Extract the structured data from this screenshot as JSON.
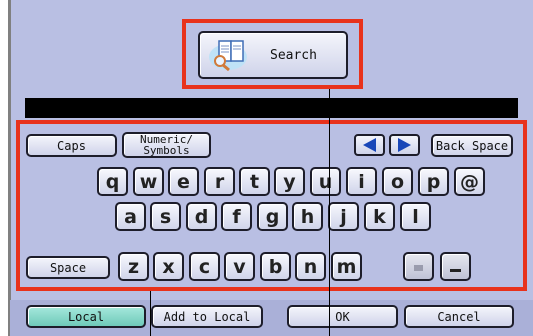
{
  "search": {
    "label": "Search",
    "icon": "book-magnifier-icon"
  },
  "toolbar": {
    "caps_label": "Caps",
    "numeric_label_line1": "Numeric/",
    "numeric_label_line2": "Symbols",
    "backspace_label": "Back Space",
    "left_arrow_icon": "triangle-left-icon",
    "right_arrow_icon": "triangle-right-icon"
  },
  "keyboard": {
    "row1": [
      "q",
      "w",
      "e",
      "r",
      "t",
      "y",
      "u",
      "i",
      "o",
      "p",
      "@"
    ],
    "row2": [
      "a",
      "s",
      "d",
      "f",
      "g",
      "h",
      "j",
      "k",
      "l"
    ],
    "row3": [
      "z",
      "x",
      "c",
      "v",
      "b",
      "n",
      "m"
    ],
    "space_label": "Space"
  },
  "bottom": {
    "local_label": "Local",
    "add_to_local_label": "Add to Local",
    "ok_label": "OK",
    "cancel_label": "Cancel"
  },
  "colors": {
    "panel": "#b9bfe3",
    "highlight": "#e8321c",
    "local_button": "#7ed4c6",
    "arrow": "#1947b8"
  }
}
